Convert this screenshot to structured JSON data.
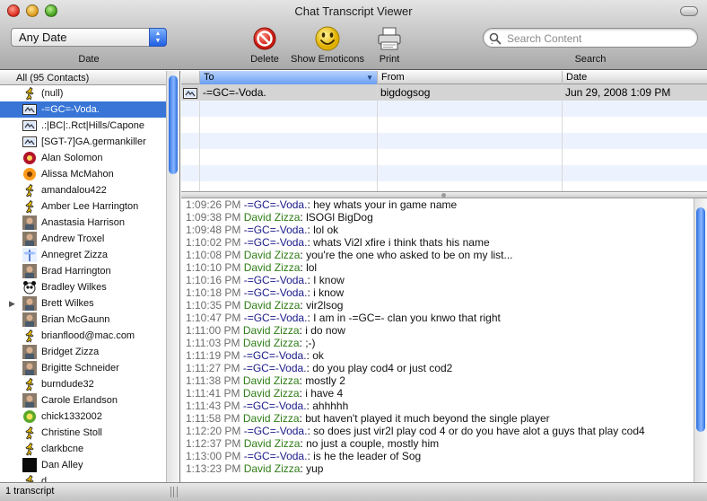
{
  "window": {
    "title": "Chat Transcript Viewer"
  },
  "toolbar": {
    "date_filter": {
      "value": "Any Date",
      "label": "Date"
    },
    "delete_label": "Delete",
    "emoticons_label": "Show Emoticons",
    "print_label": "Print",
    "search": {
      "placeholder": "Search Content",
      "label": "Search"
    }
  },
  "contacts": {
    "header": "All (95 Contacts)",
    "selected_index": 1,
    "items": [
      {
        "name": "(null)",
        "icon": "aim-running-man-icon"
      },
      {
        "name": "-=GC=-Voda.",
        "icon": "aim-buddy-card-icon"
      },
      {
        "name": ".:|BC|:.Rct|Hills/Capone",
        "icon": "aim-buddy-card-icon"
      },
      {
        "name": "[SGT-7]GA.germankiller",
        "icon": "aim-buddy-card-icon"
      },
      {
        "name": "Alan Solomon",
        "icon": "flower-avatar-icon"
      },
      {
        "name": "Alissa McMahon",
        "icon": "sunflower-avatar-icon"
      },
      {
        "name": "amandalou422",
        "icon": "aim-running-man-icon"
      },
      {
        "name": "Amber Lee Harrington",
        "icon": "aim-running-man-icon"
      },
      {
        "name": "Anastasia Harrison",
        "icon": "photo-avatar-icon"
      },
      {
        "name": "Andrew Troxel",
        "icon": "photo-avatar-icon"
      },
      {
        "name": "Annegret Zizza",
        "icon": "dragonfly-avatar-icon"
      },
      {
        "name": "Brad Harrington",
        "icon": "photo-avatar-icon"
      },
      {
        "name": "Bradley Wilkes",
        "icon": "panda-avatar-icon"
      },
      {
        "name": "Brett Wilkes",
        "icon": "photo-avatar-icon",
        "disclosure": true
      },
      {
        "name": "Brian McGaunn",
        "icon": "photo-avatar-icon"
      },
      {
        "name": "brianflood@mac.com",
        "icon": "aim-running-man-icon"
      },
      {
        "name": "Bridget Zizza",
        "icon": "photo-avatar-icon"
      },
      {
        "name": "Brigitte Schneider",
        "icon": "photo-avatar-icon"
      },
      {
        "name": "burndude32",
        "icon": "aim-running-man-icon"
      },
      {
        "name": "Carole Erlandson",
        "icon": "photo-avatar-icon"
      },
      {
        "name": "chick1332002",
        "icon": "chick-avatar-icon"
      },
      {
        "name": "Christine Stoll",
        "icon": "aim-running-man-icon"
      },
      {
        "name": "clarkbcne",
        "icon": "aim-running-man-icon"
      },
      {
        "name": "Dan Alley",
        "icon": "black-square-avatar-icon"
      },
      {
        "name": "d...",
        "icon": "aim-running-man-icon"
      }
    ]
  },
  "transcripts": {
    "columns": [
      "To",
      "From",
      "Date"
    ],
    "sorted_column": "To",
    "rows": [
      {
        "to": "-=GC=-Voda.",
        "from": "bigdogsog",
        "date": "Jun 29, 2008 1:09 PM"
      }
    ],
    "empty_rows": 5
  },
  "messages": [
    {
      "time": "1:09:26 PM",
      "sender": "-=GC=-Voda.",
      "who": "voda",
      "text": "hey whats your in game name"
    },
    {
      "time": "1:09:38 PM",
      "sender": "David Zizza",
      "who": "david",
      "text": "lSOGl BigDog"
    },
    {
      "time": "1:09:48 PM",
      "sender": "-=GC=-Voda.",
      "who": "voda",
      "text": "lol ok"
    },
    {
      "time": "1:10:02 PM",
      "sender": "-=GC=-Voda.",
      "who": "voda",
      "text": "whats Vi2l xfire i think thats his name"
    },
    {
      "time": "1:10:08 PM",
      "sender": "David Zizza",
      "who": "david",
      "text": "you're the one who asked to be on my list..."
    },
    {
      "time": "1:10:10 PM",
      "sender": "David Zizza",
      "who": "david",
      "text": "lol"
    },
    {
      "time": "1:10:16 PM",
      "sender": "-=GC=-Voda.",
      "who": "voda",
      "text": "I know"
    },
    {
      "time": "1:10:18 PM",
      "sender": "-=GC=-Voda.",
      "who": "voda",
      "text": "i know"
    },
    {
      "time": "1:10:35 PM",
      "sender": "David Zizza",
      "who": "david",
      "text": "vir2lsog"
    },
    {
      "time": "1:10:47 PM",
      "sender": "-=GC=-Voda.",
      "who": "voda",
      "text": "I am in -=GC=- clan you knwo that right"
    },
    {
      "time": "1:11:00 PM",
      "sender": "David Zizza",
      "who": "david",
      "text": "i do now"
    },
    {
      "time": "1:11:03 PM",
      "sender": "David Zizza",
      "who": "david",
      "text": ";-)"
    },
    {
      "time": "1:11:19 PM",
      "sender": "-=GC=-Voda.",
      "who": "voda",
      "text": "ok"
    },
    {
      "time": "1:11:27 PM",
      "sender": "-=GC=-Voda.",
      "who": "voda",
      "text": "do you play cod4 or just cod2"
    },
    {
      "time": "1:11:38 PM",
      "sender": "David Zizza",
      "who": "david",
      "text": "mostly 2"
    },
    {
      "time": "1:11:41 PM",
      "sender": "David Zizza",
      "who": "david",
      "text": "i have 4"
    },
    {
      "time": "1:11:43 PM",
      "sender": "-=GC=-Voda.",
      "who": "voda",
      "text": "ahhhhh"
    },
    {
      "time": "1:11:58 PM",
      "sender": "David Zizza",
      "who": "david",
      "text": "but haven't played it much beyond the single player"
    },
    {
      "time": "1:12:20 PM",
      "sender": "-=GC=-Voda.",
      "who": "voda",
      "text": "so does just vir2l play cod 4 or do you have alot a guys that play cod4"
    },
    {
      "time": "1:12:37 PM",
      "sender": "David Zizza",
      "who": "david",
      "text": "no just a couple, mostly him"
    },
    {
      "time": "1:13:00 PM",
      "sender": "-=GC=-Voda.",
      "who": "voda",
      "text": "is he the leader of Sog"
    },
    {
      "time": "1:13:23 PM",
      "sender": "David Zizza",
      "who": "david",
      "text": "yup"
    }
  ],
  "statusbar": {
    "text": "1 transcript"
  },
  "colors": {
    "selection": "#3875d7",
    "sender_voda": "#1a1a8a",
    "sender_david": "#2e7d16",
    "row_alt": "#edf3fe",
    "scroll_thumb": "#2d6fe0"
  }
}
